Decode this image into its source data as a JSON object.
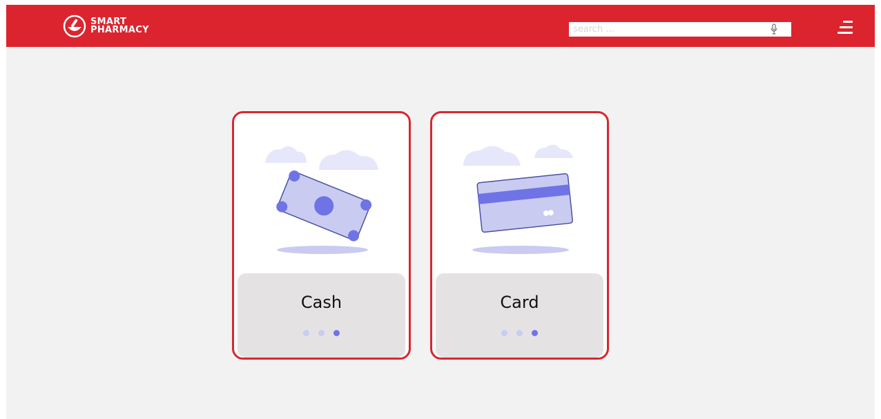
{
  "header": {
    "brand_line1": "SMART",
    "brand_line2": "PHARMACY",
    "search_placeholder": "search ...",
    "icons": {
      "logo": "mortar-pestle-logo",
      "mic": "microphone-icon",
      "menu": "hamburger-menu-icon"
    }
  },
  "payment_options": [
    {
      "label": "Cash",
      "icon": "banknote-illustration",
      "dots": 3,
      "active_dot": 3
    },
    {
      "label": "Card",
      "icon": "credit-card-illustration",
      "dots": 3,
      "active_dot": 3
    }
  ],
  "colors": {
    "brand_red": "#dc242f",
    "card_border": "#d7272f",
    "accent_blue": "#6e73e6",
    "light_blue": "#c9cbf1",
    "background": "#f2f2f2"
  }
}
